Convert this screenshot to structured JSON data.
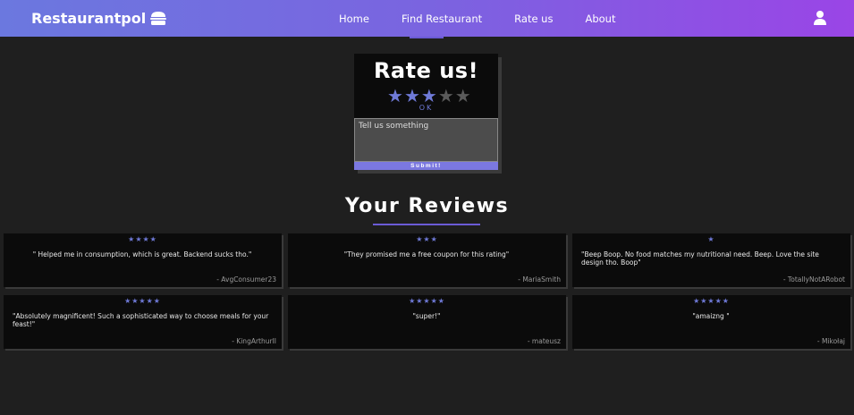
{
  "navbar": {
    "brand": "Restaurantpol",
    "links": [
      "Home",
      "Find Restaurant",
      "Rate us",
      "About"
    ],
    "accent": "#6b78df"
  },
  "rate": {
    "title": "Rate us!",
    "rating": 3,
    "max": 5,
    "caption": "OK",
    "placeholder": "Tell us something",
    "submit": "Submit!"
  },
  "reviews_section": {
    "title": "Your Reviews",
    "items": [
      {
        "stars": "★★★★",
        "rating": 4,
        "text": "\" Helped me in consumption, which is great. Backend sucks tho.\"",
        "author": "- AvgConsumer23"
      },
      {
        "stars": "★★★",
        "rating": 3,
        "text": "\"They promised me a free coupon for this rating\"",
        "author": "- MariaSmith"
      },
      {
        "stars": "★",
        "rating": 1,
        "text": "\"Beep Boop. No food matches my nutritional need. Beep. Love the site design tho. Boop\"",
        "author": "- TotallyNotARobot"
      },
      {
        "stars": "★★★★★",
        "rating": 5,
        "text": "\"Absolutely magnificent! Such a sophisticated way to choose meals for your feast!\"",
        "author": "- KingArthurII"
      },
      {
        "stars": "★★★★★",
        "rating": 5,
        "text": "\"super!\"",
        "author": "- mateusz"
      },
      {
        "stars": "★★★★★",
        "rating": 5,
        "text": "\"amaizng \"",
        "author": "- Mikołaj"
      }
    ]
  },
  "colors": {
    "background": "#1f1f1f",
    "card": "#0b0b0b",
    "star_active": "#6f7ad8",
    "star_inactive": "#5a5a5a",
    "submit": "#7b78e0"
  }
}
